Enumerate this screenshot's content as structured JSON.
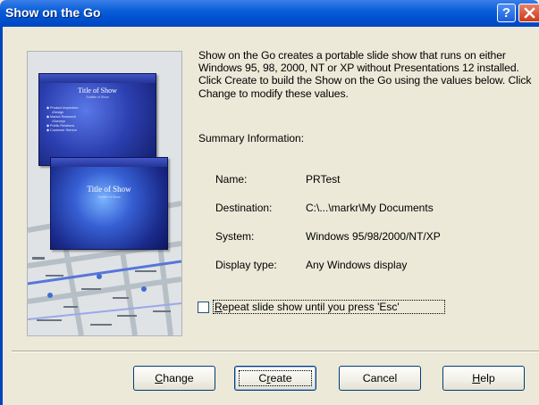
{
  "window": {
    "title": "Show on the Go",
    "help_glyph": "?",
    "colors": {
      "titlebar": "#0050d0",
      "face": "#ece9d8",
      "close": "#cc3a16"
    }
  },
  "preview": {
    "back_slide": {
      "title": "Title of Show",
      "subtitle": "Subtitle of Show",
      "bullets": [
        "Product Inspection",
        "Design",
        "Market Research",
        "Surveys",
        "Public Relations",
        "Customer Service"
      ]
    },
    "front_slide": {
      "title": "Title of Show",
      "subtitle": "Subtitle of Show"
    }
  },
  "description": "Show on the Go creates a portable slide show that runs on either Windows 95, 98, 2000, NT or XP without Presentations 12 installed.  Click Create to build the Show on the Go using the values below.  Click Change to modify these values.",
  "summary": {
    "heading": "Summary Information:",
    "rows": [
      {
        "label": "Name:",
        "value": "PRTest"
      },
      {
        "label": "Destination:",
        "value": "C:\\...\\markr\\My Documents"
      },
      {
        "label": "System:",
        "value": "Windows 95/98/2000/NT/XP"
      },
      {
        "label": "Display type:",
        "value": "Any Windows display"
      }
    ]
  },
  "repeat_option": {
    "accel": "R",
    "rest": "epeat slide show until you press 'Esc'",
    "checked": false
  },
  "buttons": {
    "change": {
      "accel": "C",
      "rest": "hange"
    },
    "create": {
      "pre": "C",
      "accel": "r",
      "rest": "eate"
    },
    "cancel": {
      "label": "Cancel"
    },
    "help": {
      "accel": "H",
      "rest": "elp"
    }
  }
}
